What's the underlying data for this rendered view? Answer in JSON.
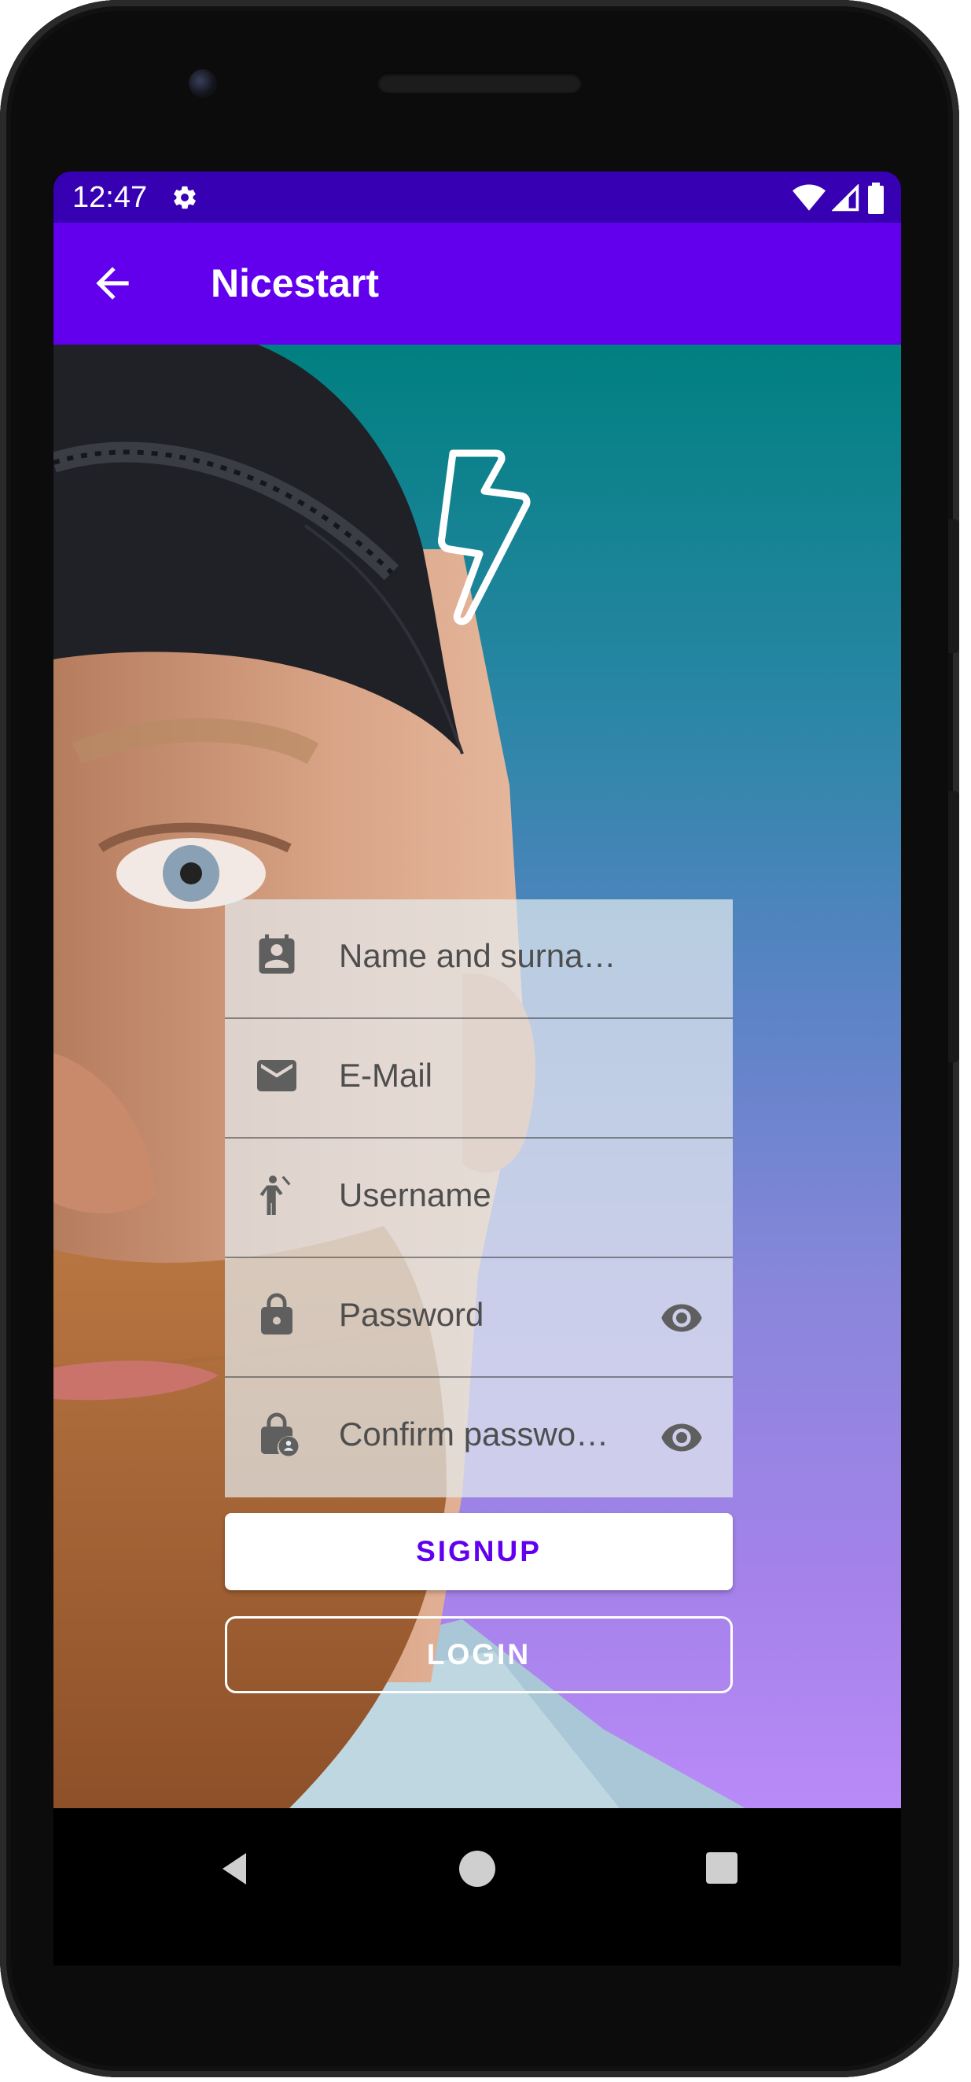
{
  "status_bar": {
    "time": "12:47",
    "icons": [
      "gear-icon",
      "wifi-icon",
      "signal-icon",
      "battery-icon"
    ]
  },
  "app_bar": {
    "title": "Nicestart",
    "back_icon": "arrow-back-icon"
  },
  "logo": {
    "icon": "lightning-bolt-icon"
  },
  "form": {
    "fields": [
      {
        "icon": "contact-card-icon",
        "placeholder": "Name and surname"
      },
      {
        "icon": "mail-icon",
        "placeholder": "E-Mail"
      },
      {
        "icon": "person-wave-icon",
        "placeholder": "Username"
      },
      {
        "icon": "lock-icon",
        "placeholder": "Password",
        "trailing_icon": "eye-icon"
      },
      {
        "icon": "lock-person-icon",
        "placeholder": "Confirm passwo…",
        "trailing_icon": "eye-icon"
      }
    ]
  },
  "buttons": {
    "signup_label": "SIGNUP",
    "login_label": "LOGIN"
  },
  "nav_bar": {
    "icons": [
      "nav-back-icon",
      "nav-home-icon",
      "nav-recents-icon"
    ]
  },
  "colors": {
    "status_bar": "#3700b3",
    "app_bar": "#6200ee",
    "accent": "#6200ee",
    "gradient_top": "#008080",
    "gradient_bottom": "#b98af8"
  }
}
